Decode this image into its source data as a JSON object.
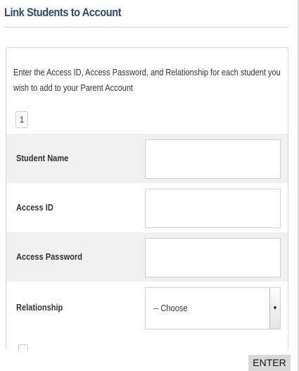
{
  "page": {
    "title": "Link Students to Account"
  },
  "form": {
    "instructions": "Enter the Access ID, Access Password, and Relationship for each student you wish to add to your Parent Account",
    "student_index": "1",
    "fields": [
      {
        "label": "Student Name",
        "value": ""
      },
      {
        "label": "Access ID",
        "value": ""
      },
      {
        "label": "Access Password",
        "value": ""
      }
    ],
    "relationship": {
      "label": "Relationship",
      "selected": "-- Choose"
    }
  },
  "actions": {
    "enter_label": "ENTER"
  },
  "icons": {
    "select_arrow": "caret-down-icon"
  }
}
